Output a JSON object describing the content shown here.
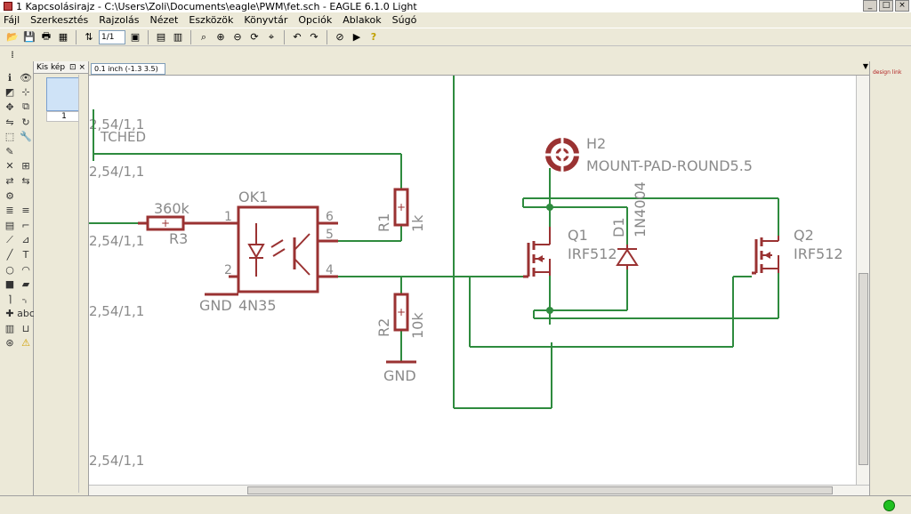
{
  "window": {
    "title": "1 Kapcsolásirajz - C:\\Users\\Zoli\\Documents\\eagle\\PWM\\fet.sch - EAGLE 6.1.0 Light",
    "buttons": [
      "_",
      "□",
      "×"
    ]
  },
  "menu": {
    "items": [
      "Fájl",
      "Szerkesztés",
      "Rajzolás",
      "Nézet",
      "Eszközök",
      "Könyvtár",
      "Opciók",
      "Ablakok",
      "Súgó"
    ]
  },
  "toolbar": {
    "sheet_select": "1/1"
  },
  "thumbnails": {
    "tab_label": "Kis kép",
    "page_number": "1"
  },
  "coord": {
    "display": "0.1 inch (-1.3 3.5)"
  },
  "schematic": {
    "frame_labels": [
      "2,54/1,1",
      "2,54/1,1",
      "2,54/1,1",
      "2,54/1,1",
      "2,54/1,1"
    ],
    "partial_label": "TCHED",
    "r3": {
      "name": "R3",
      "value": "360k"
    },
    "ok1": {
      "name": "OK1",
      "value": "4N35",
      "pins": [
        "1",
        "2",
        "4",
        "5",
        "6"
      ]
    },
    "r1": {
      "name": "R1",
      "value": "1k"
    },
    "r2": {
      "name": "R2",
      "value": "10k"
    },
    "gnd_left": "GND",
    "gnd_right": "GND",
    "h2": {
      "name": "H2",
      "value": "MOUNT-PAD-ROUND5.5"
    },
    "q1": {
      "name": "Q1",
      "value": "IRF512"
    },
    "d1": {
      "name": "D1",
      "value": "1N4004"
    },
    "q2": {
      "name": "Q2",
      "value": "IRF512"
    }
  },
  "colors": {
    "wire": "#2e8b3e",
    "part": "#9a3232",
    "label": "#8a8a8a"
  },
  "status": {
    "indicator": "green"
  },
  "logo": {
    "text": "design link"
  }
}
